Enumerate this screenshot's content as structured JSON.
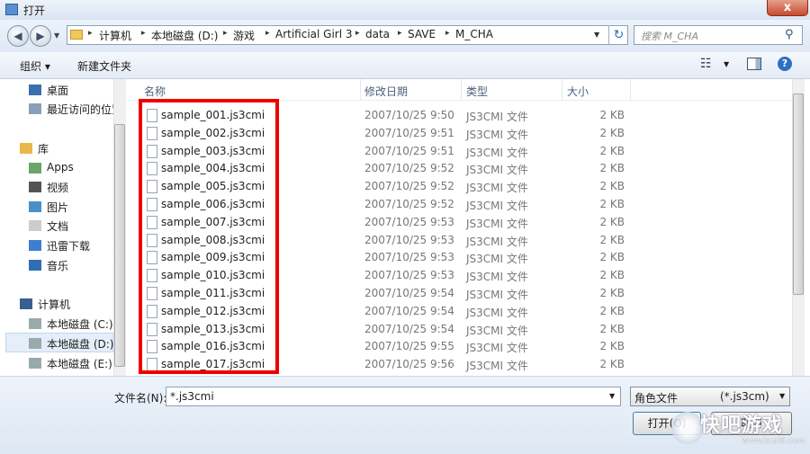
{
  "window": {
    "title": "打开",
    "close_glyph": "x"
  },
  "nav": {
    "back_glyph": "◀",
    "forward_glyph": "▶",
    "dropdown_glyph": "▼"
  },
  "address": {
    "crumbs": [
      "计算机",
      "本地磁盘 (D:)",
      "游戏",
      "Artificial Girl 3",
      "data",
      "SAVE",
      "M_CHA"
    ],
    "separator": "▸",
    "dropdown_glyph": "▼",
    "refresh_glyph": "↻"
  },
  "search": {
    "placeholder": "搜索 M_CHA",
    "icon": "search-icon",
    "glyph": "⚲"
  },
  "toolbar": {
    "organize_label": "组织 ▾",
    "new_folder_label": "新建文件夹",
    "view_glyph": "☷",
    "view_dropdown": "▼",
    "help_glyph": "?"
  },
  "sidebar": {
    "items": [
      {
        "label": "桌面",
        "icon": "desktop-icon"
      },
      {
        "label": "最近访问的位置",
        "icon": "recent-places-icon"
      },
      {
        "label": "库",
        "icon": "library-icon"
      },
      {
        "label": "Apps",
        "icon": "apps-icon"
      },
      {
        "label": "视频",
        "icon": "video-icon"
      },
      {
        "label": "图片",
        "icon": "pictures-icon"
      },
      {
        "label": "文档",
        "icon": "documents-icon"
      },
      {
        "label": "迅雷下载",
        "icon": "download-icon"
      },
      {
        "label": "音乐",
        "icon": "music-icon"
      },
      {
        "label": "计算机",
        "icon": "computer-icon"
      },
      {
        "label": "本地磁盘 (C:)",
        "icon": "drive-icon"
      },
      {
        "label": "本地磁盘 (D:)",
        "icon": "drive-icon",
        "selected": true
      },
      {
        "label": "本地磁盘 (E:)",
        "icon": "drive-icon"
      }
    ]
  },
  "columns": {
    "name": "名称",
    "date": "修改日期",
    "type": "类型",
    "size": "大小"
  },
  "files": [
    {
      "name": "sample_001.js3cmi",
      "date": "2007/10/25 9:50",
      "type": "JS3CMI 文件",
      "size": "2 KB"
    },
    {
      "name": "sample_002.js3cmi",
      "date": "2007/10/25 9:51",
      "type": "JS3CMI 文件",
      "size": "2 KB"
    },
    {
      "name": "sample_003.js3cmi",
      "date": "2007/10/25 9:51",
      "type": "JS3CMI 文件",
      "size": "2 KB"
    },
    {
      "name": "sample_004.js3cmi",
      "date": "2007/10/25 9:52",
      "type": "JS3CMI 文件",
      "size": "2 KB"
    },
    {
      "name": "sample_005.js3cmi",
      "date": "2007/10/25 9:52",
      "type": "JS3CMI 文件",
      "size": "2 KB"
    },
    {
      "name": "sample_006.js3cmi",
      "date": "2007/10/25 9:52",
      "type": "JS3CMI 文件",
      "size": "2 KB"
    },
    {
      "name": "sample_007.js3cmi",
      "date": "2007/10/25 9:53",
      "type": "JS3CMI 文件",
      "size": "2 KB"
    },
    {
      "name": "sample_008.js3cmi",
      "date": "2007/10/25 9:53",
      "type": "JS3CMI 文件",
      "size": "2 KB"
    },
    {
      "name": "sample_009.js3cmi",
      "date": "2007/10/25 9:53",
      "type": "JS3CMI 文件",
      "size": "2 KB"
    },
    {
      "name": "sample_010.js3cmi",
      "date": "2007/10/25 9:53",
      "type": "JS3CMI 文件",
      "size": "2 KB"
    },
    {
      "name": "sample_011.js3cmi",
      "date": "2007/10/25 9:54",
      "type": "JS3CMI 文件",
      "size": "2 KB"
    },
    {
      "name": "sample_012.js3cmi",
      "date": "2007/10/25 9:54",
      "type": "JS3CMI 文件",
      "size": "2 KB"
    },
    {
      "name": "sample_013.js3cmi",
      "date": "2007/10/25 9:54",
      "type": "JS3CMI 文件",
      "size": "2 KB"
    },
    {
      "name": "sample_016.js3cmi",
      "date": "2007/10/25 9:55",
      "type": "JS3CMI 文件",
      "size": "2 KB"
    },
    {
      "name": "sample_017.js3cmi",
      "date": "2007/10/25 9:56",
      "type": "JS3CMI 文件",
      "size": "2 KB"
    }
  ],
  "bottom": {
    "filename_label": "文件名(N):",
    "filename_value": "*.js3cmi",
    "filename_dropdown": "▼",
    "filter_label": "角色文件",
    "filter_ext": "(*.js3cm)",
    "filter_dropdown": "▼",
    "open_label": "打开(O)",
    "cancel_label": "取消"
  },
  "watermark": {
    "text": "快吧游戏",
    "url": "www.kuai8.com"
  },
  "colors": {
    "highlight": "#ee0000",
    "accent": "#2f6fc0"
  }
}
